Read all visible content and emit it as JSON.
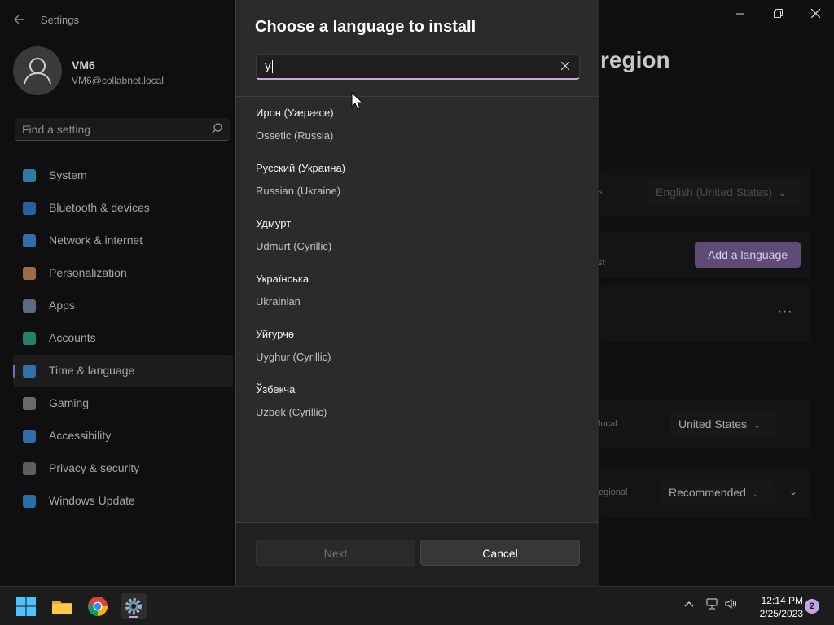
{
  "settings": {
    "app_title": "Settings",
    "profile": {
      "name": "VM6",
      "email": "VM6@collabnet.local"
    },
    "search_placeholder": "Find a setting",
    "nav_items": [
      {
        "label": "System",
        "icon": "monitor-icon",
        "color": "#3aa0d8"
      },
      {
        "label": "Bluetooth & devices",
        "icon": "bluetooth-icon",
        "color": "#2f7fd0"
      },
      {
        "label": "Network & internet",
        "icon": "wifi-icon",
        "color": "#3d8fe0"
      },
      {
        "label": "Personalization",
        "icon": "brush-icon",
        "color": "#d08a5a"
      },
      {
        "label": "Apps",
        "icon": "apps-icon",
        "color": "#7b8ca6"
      },
      {
        "label": "Accounts",
        "icon": "person-icon",
        "color": "#2fa88a"
      },
      {
        "label": "Time & language",
        "icon": "globe-clock-icon",
        "color": "#3b8fd6"
      },
      {
        "label": "Gaming",
        "icon": "controller-icon",
        "color": "#8a8a8a"
      },
      {
        "label": "Accessibility",
        "icon": "accessibility-icon",
        "color": "#3a90e0"
      },
      {
        "label": "Privacy & security",
        "icon": "shield-icon",
        "color": "#7a7a7a"
      },
      {
        "label": "Windows Update",
        "icon": "update-icon",
        "color": "#2f8fd8"
      }
    ],
    "active_nav": "Time & language",
    "page_title_fragment": "region",
    "windows_display_language": "English (United States)",
    "add_language_label": "Add a language",
    "region_fragment": "local",
    "country_value": "United States",
    "regional_fragment": "egional",
    "regional_format_value": "Recommended",
    "frag_s": "s",
    "frag_st": "st"
  },
  "dialog": {
    "title": "Choose a language to install",
    "search_value": "у",
    "languages": [
      {
        "native": "Ирон (Уæрæсе)",
        "english": "Ossetic (Russia)"
      },
      {
        "native": "Русский (Украина)",
        "english": "Russian (Ukraine)"
      },
      {
        "native": "Удмурт",
        "english": "Udmurt (Cyrillic)"
      },
      {
        "native": "Українська",
        "english": "Ukrainian"
      },
      {
        "native": "Уйғурчә",
        "english": "Uyghur (Cyrillic)"
      },
      {
        "native": "Ўзбекча",
        "english": "Uzbek (Cyrillic)"
      }
    ],
    "next_label": "Next",
    "cancel_label": "Cancel"
  },
  "taskbar": {
    "time": "12:14 PM",
    "date": "2/25/2023",
    "notification_count": "2"
  }
}
